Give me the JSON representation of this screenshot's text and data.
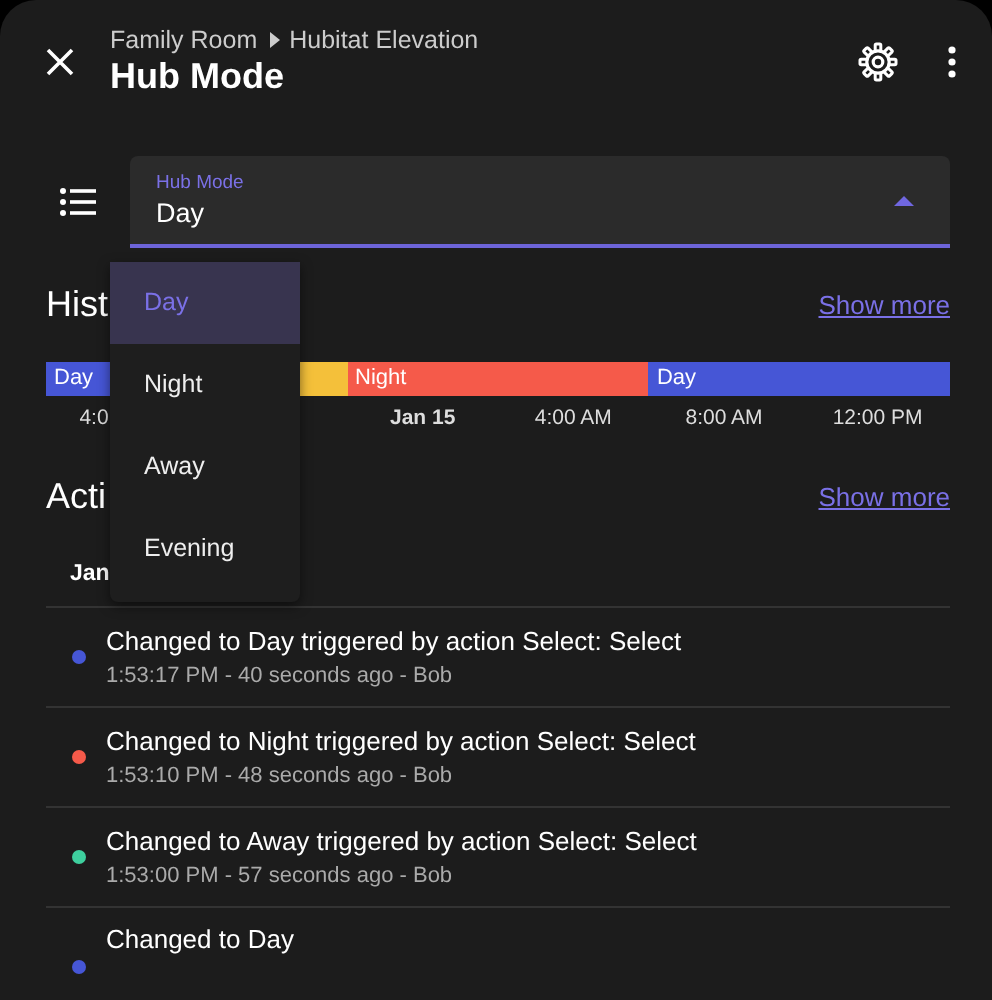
{
  "header": {
    "breadcrumb": [
      "Family Room",
      "Hubitat Elevation"
    ],
    "title": "Hub Mode"
  },
  "select": {
    "label": "Hub Mode",
    "value": "Day",
    "expanded": true,
    "options": [
      {
        "label": "Day",
        "selected": true
      },
      {
        "label": "Night",
        "selected": false
      },
      {
        "label": "Away",
        "selected": false
      },
      {
        "label": "Evening",
        "selected": false
      }
    ]
  },
  "history": {
    "title": "Hist",
    "link": "Show more",
    "timeline": {
      "segments": [
        {
          "label": "Day",
          "color": "#4656d6"
        },
        {
          "color": "#f4c03a"
        },
        {
          "label": "Night",
          "color": "#f55a4a"
        },
        {
          "label": "Day",
          "color": "#4656d6"
        }
      ],
      "ticks": [
        {
          "label": "4:0",
          "bold": false
        },
        {
          "label": "Jan 15",
          "bold": true
        },
        {
          "label": "4:00 AM",
          "bold": false
        },
        {
          "label": "8:00 AM",
          "bold": false
        },
        {
          "label": "12:00 PM",
          "bold": false
        }
      ]
    }
  },
  "activity": {
    "title": "Acti",
    "link": "Show more",
    "date": "Jan",
    "items": [
      {
        "title": "Changed to Day triggered by action Select: Select",
        "subtitle": "1:53:17 PM - 40 seconds ago - Bob",
        "color": "#4656d6"
      },
      {
        "title": "Changed to Night triggered by action Select: Select",
        "subtitle": "1:53:10 PM - 48 seconds ago - Bob",
        "color": "#f55a4a"
      },
      {
        "title": "Changed to Away triggered by action Select: Select",
        "subtitle": "1:53:00 PM - 57 seconds ago - Bob",
        "color": "#3ecf9e"
      },
      {
        "title": "Changed to Day",
        "color": "#4656d6"
      }
    ]
  }
}
